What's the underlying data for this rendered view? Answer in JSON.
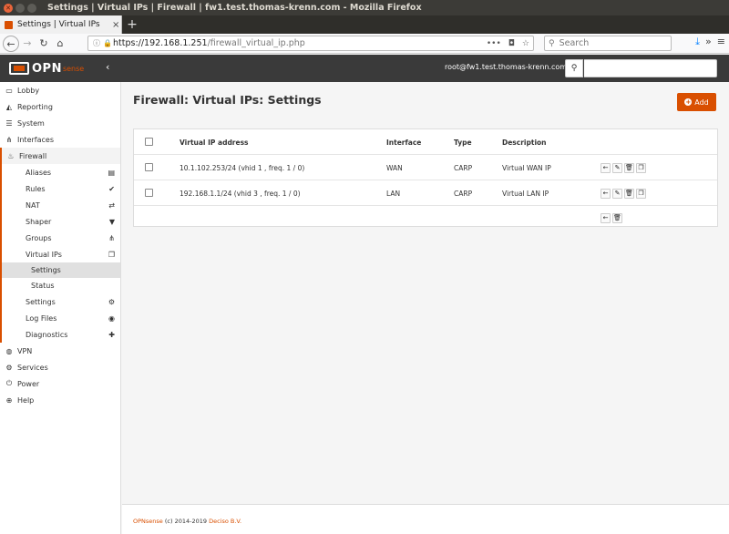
{
  "window": {
    "title": "Settings | Virtual IPs | Firewall | fw1.test.thomas-krenn.com - Mozilla Firefox",
    "tab_label": "Settings | Virtual IPs",
    "new_tab": "+",
    "close": "×"
  },
  "browser": {
    "url_host": "https://192.168.1.251",
    "url_path": "/firewall_virtual_ip.php",
    "search_placeholder": "Search"
  },
  "header": {
    "logo_opn": "OPN",
    "logo_sense": "sense",
    "user": "root@fw1.test.thomas-krenn.com"
  },
  "sidebar": {
    "top_items": [
      {
        "label": "Lobby",
        "icon": "laptop-icon"
      },
      {
        "label": "Reporting",
        "icon": "area-chart-icon"
      },
      {
        "label": "System",
        "icon": "server-icon"
      },
      {
        "label": "Interfaces",
        "icon": "sitemap-icon"
      }
    ],
    "firewall": {
      "label": "Firewall",
      "children": [
        {
          "label": "Aliases",
          "icon": "list-alt-icon"
        },
        {
          "label": "Rules",
          "icon": "check-icon"
        },
        {
          "label": "NAT",
          "icon": "exchange-icon"
        },
        {
          "label": "Shaper",
          "icon": "filter-icon"
        },
        {
          "label": "Groups",
          "icon": "sitemap-icon"
        },
        {
          "label": "Virtual IPs",
          "icon": "clone-icon"
        }
      ],
      "vip_children": [
        {
          "label": "Settings"
        },
        {
          "label": "Status"
        }
      ],
      "after": [
        {
          "label": "Settings",
          "icon": "cogs-icon"
        },
        {
          "label": "Log Files",
          "icon": "eye-icon"
        },
        {
          "label": "Diagnostics",
          "icon": "medkit-icon"
        }
      ]
    },
    "bottom_items": [
      {
        "label": "VPN",
        "icon": "globe-icon"
      },
      {
        "label": "Services",
        "icon": "cog-icon"
      },
      {
        "label": "Power",
        "icon": "plug-icon"
      },
      {
        "label": "Help",
        "icon": "life-ring-icon"
      }
    ]
  },
  "main": {
    "title": "Firewall: Virtual IPs: Settings",
    "add_label": "Add",
    "columns": [
      "Virtual IP address",
      "Interface",
      "Type",
      "Description"
    ],
    "rows": [
      {
        "address": "10.1.102.253/24 (vhid 1 , freq. 1 / 0)",
        "interface": "WAN",
        "type": "CARP",
        "description": "Virtual WAN IP"
      },
      {
        "address": "192.168.1.1/24 (vhid 3 , freq. 1 / 0)",
        "interface": "LAN",
        "type": "CARP",
        "description": "Virtual LAN IP"
      }
    ]
  },
  "footer": {
    "brand": "OPNsense",
    "copy": " (c) 2014-2019 ",
    "company": "Deciso B.V."
  },
  "colors": {
    "accent": "#d94f00",
    "header_bg": "#3a3a3a"
  }
}
